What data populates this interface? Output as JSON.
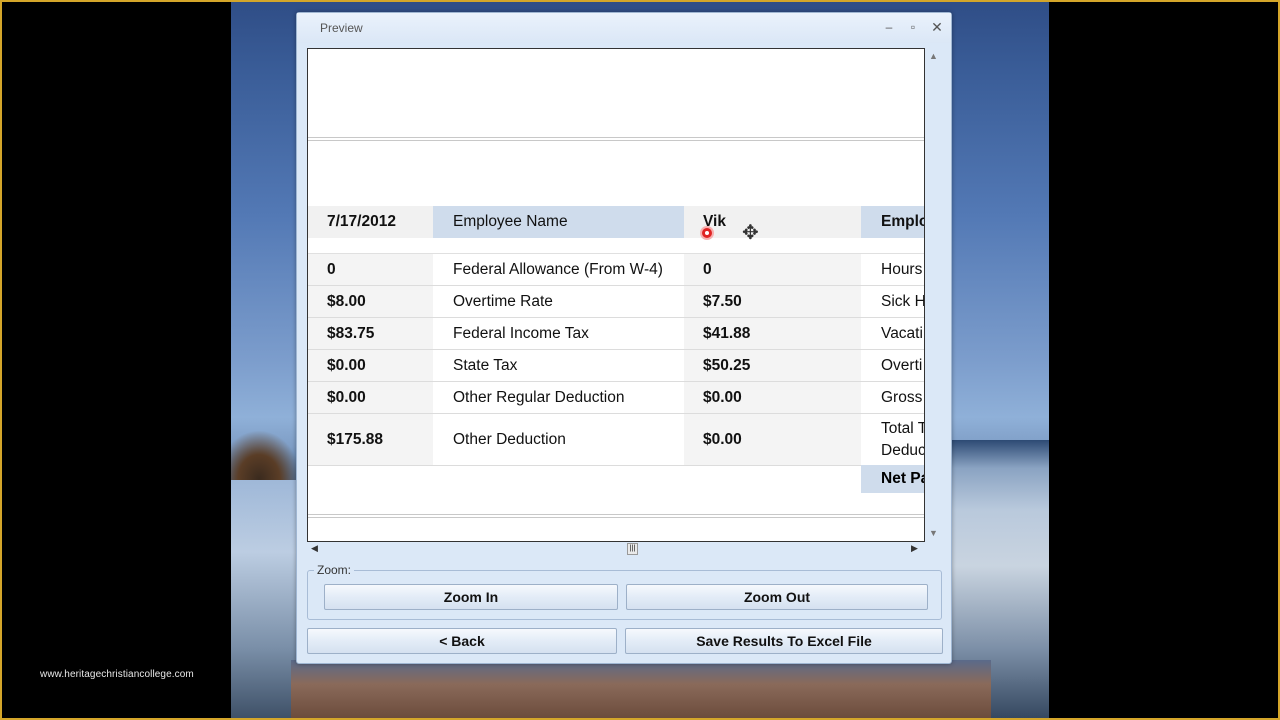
{
  "watermark": "www.heritagechristiancollege.com",
  "window": {
    "title": "Preview",
    "controls": {
      "minimize": "–",
      "maximize": "▫",
      "close": "✕"
    }
  },
  "report": {
    "header": {
      "date": "7/17/2012",
      "label": "Employee Name",
      "value": "Vik",
      "right": "Emplo"
    },
    "rows": [
      {
        "c1": "0",
        "c2": "Federal Allowance (From W-4)",
        "c3": "0",
        "c4": "Hours"
      },
      {
        "c1": "$8.00",
        "c2": "Overtime Rate",
        "c3": "$7.50",
        "c4": "Sick H"
      },
      {
        "c1": "$83.75",
        "c2": "Federal Income Tax",
        "c3": "$41.88",
        "c4": "Vacati"
      },
      {
        "c1": "$0.00",
        "c2": "State Tax",
        "c3": "$50.25",
        "c4": "Overti"
      },
      {
        "c1": "$0.00",
        "c2": "Other Regular Deduction",
        "c3": "$0.00",
        "c4": "Gross"
      },
      {
        "c1": "$175.88",
        "c2": "Other Deduction",
        "c3": "$0.00",
        "c4_line1": "Total T",
        "c4_line2": "Deduc"
      }
    ],
    "net_pay": "Net Pa"
  },
  "scroll": {
    "up": "▲",
    "down": "▼",
    "left": "◀",
    "right": "▶",
    "thumb": "|||"
  },
  "zoom": {
    "legend": "Zoom:",
    "zoom_in": "Zoom In",
    "zoom_out": "Zoom Out"
  },
  "footer": {
    "back": "< Back",
    "save": "Save Results To Excel File"
  },
  "cursor": {
    "move": "✥"
  }
}
